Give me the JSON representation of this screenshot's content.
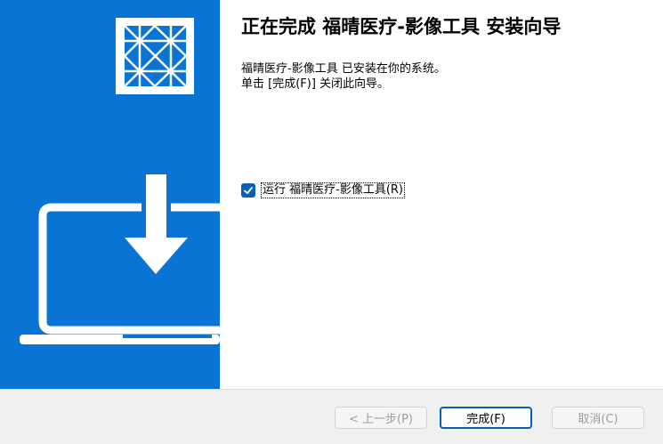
{
  "heading": "正在完成 福晴医疗-影像工具 安装向导",
  "description": {
    "line1": "福晴医疗-影像工具 已安装在你的系统。",
    "line2": "单击 [完成(F)] 关闭此向导。"
  },
  "run_option": {
    "label": "运行 福晴医疗-影像工具(R)",
    "checked": true
  },
  "buttons": {
    "back": "< 上一步(P)",
    "finish": "完成(F)",
    "cancel": "取消(C)"
  },
  "colors": {
    "banner": "#0a74d4",
    "accent": "#0a5fb4"
  },
  "icons": {
    "logo": "installer-logo-icon",
    "download": "download-arrow-icon",
    "laptop": "laptop-icon",
    "check": "check-icon"
  }
}
